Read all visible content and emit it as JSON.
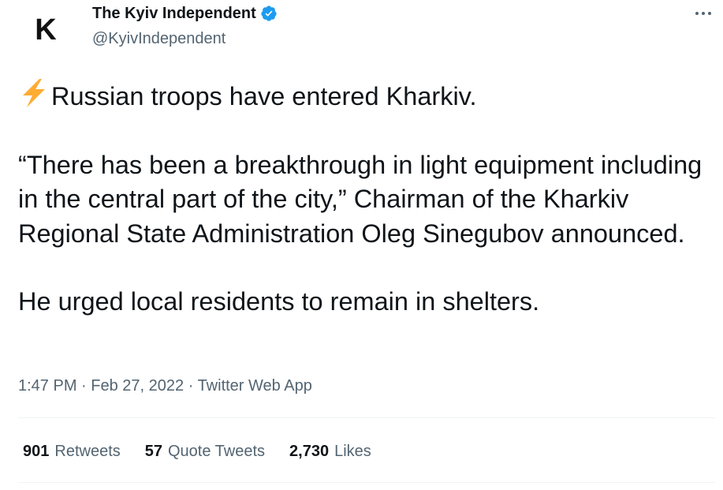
{
  "author": {
    "avatar_letter": "K",
    "display_name": "The Kyiv Independent",
    "handle": "@KyivIndependent",
    "verified": true
  },
  "tweet": {
    "emoji": "lightning-bolt",
    "paragraphs": [
      "Russian troops have entered Kharkiv.",
      "“There has been a breakthrough in light equipment including in the central part of the city,” Chairman of the Kharkiv Regional State Administration Oleg Sinegubov announced.",
      "He urged local residents to remain in shelters."
    ]
  },
  "meta": {
    "time": "1:47 PM",
    "date": "Feb 27, 2022",
    "source": "Twitter Web App",
    "separator": " · "
  },
  "stats": [
    {
      "count": "901",
      "label": "Retweets"
    },
    {
      "count": "57",
      "label": "Quote Tweets"
    },
    {
      "count": "2,730",
      "label": "Likes"
    }
  ],
  "colors": {
    "text_primary": "#0f1419",
    "text_secondary": "#536471",
    "verified_blue": "#1d9bf0",
    "bolt_yellow": "#ffac33",
    "divider": "#eff3f4"
  },
  "icons": {
    "more": "more-horizontal-icon",
    "verified": "verified-badge-icon",
    "bolt": "high-voltage-emoji"
  }
}
